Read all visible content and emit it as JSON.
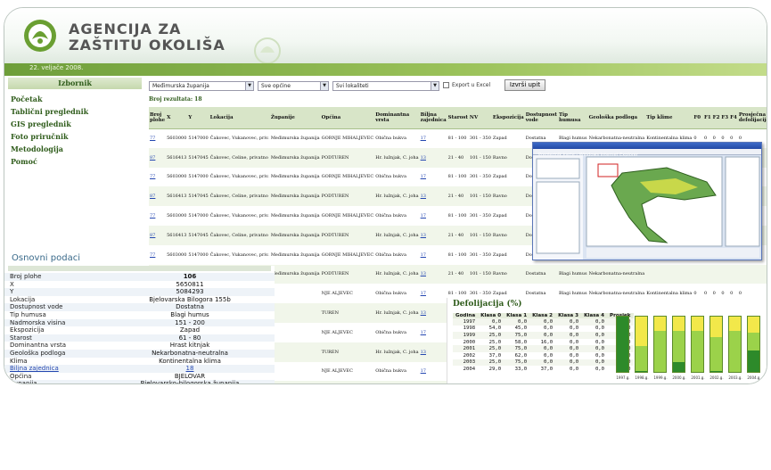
{
  "header": {
    "agency_line1": "AGENCIJA ZA",
    "agency_line2": "ZAŠTITU OKOLIŠA",
    "date": "22. veljače 2008."
  },
  "sidebar": {
    "title": "Izbornik",
    "items": [
      "Početak",
      "Tablični preglednik",
      "GIS preglednik",
      "Foto priručnik",
      "Metodologija",
      "Pomoć"
    ]
  },
  "filters": {
    "county": "Međimurska županija",
    "municipality": "Sve općine",
    "locality": "Svi lokaliteti",
    "export_label": "Export u Excel",
    "submit": "Izvrši upit"
  },
  "results": {
    "label": "Broj rezultata: 18"
  },
  "table": {
    "headers": [
      "Broj plohe",
      "X",
      "Y",
      "Lokacija",
      "Županije",
      "Općina",
      "Dominantna vrsta",
      "Biljna zajednica",
      "Starost",
      "NV",
      "Ekspozicija",
      "Dostupnost vode",
      "Tip humusa",
      "Geološka podloga",
      "Tip klime",
      "F0",
      "F1",
      "F2",
      "F3",
      "F4",
      "Prosječna defolijacija",
      "C0",
      "C1",
      "C2",
      "C3",
      "Prosječna diskoloracija",
      "Godina"
    ],
    "rows": [
      [
        "77",
        "5603000",
        "5147000",
        "Čakovec, Vukanovec, priv.",
        "Međimurska županija",
        "GORNJE MIHALJEVEC",
        "Obična bukva",
        "17",
        "81 - 100",
        "301 - 350",
        "Zapad",
        "Dostatna",
        "Blagi humus",
        "Nekarbonatna-neutralna",
        "Kontinentalna klima",
        "0",
        "0",
        "0",
        "0",
        "0",
        "0",
        "0",
        "0",
        "0",
        "0",
        "0",
        "1997"
      ],
      [
        "87",
        "5616413",
        "5147045",
        "Čakovec, Celine, privatno",
        "Međimurska županija",
        "PODTUREN",
        "Hr. lužnjak, C. joha",
        "13",
        "21 - 40",
        "101 - 150",
        "Ravno",
        "Dostatna",
        "Blagi humus",
        "Nekarbonatna-neutralna",
        "Kontinentalna klima",
        "0",
        "0",
        "0",
        "0",
        "0",
        "0",
        "0",
        "0",
        "0",
        "0",
        "0",
        "1997"
      ],
      [
        "77",
        "5603000",
        "5147000",
        "Čakovec, Vukanovec, priv.",
        "Međimurska županija",
        "GORNJE MIHALJEVEC",
        "Obična bukva",
        "17",
        "81 - 100",
        "301 - 350",
        "Zapad",
        "Dostatna",
        "Blagi humus",
        "Nekarbonatna-neutralna",
        "",
        "",
        "",
        "",
        "",
        "",
        "",
        "",
        "",
        "",
        "",
        "",
        ""
      ],
      [
        "87",
        "5616413",
        "5147045",
        "Čakovec, Celine, privatno",
        "Međimurska županija",
        "PODTUREN",
        "Hr. lužnjak, C. joha",
        "13",
        "21 - 40",
        "101 - 150",
        "Ravno",
        "Dostatna",
        "Blagi humus",
        "Nekarbonatna-neutralna",
        "",
        "",
        "",
        "",
        "",
        "",
        "",
        "",
        "",
        "",
        "",
        "",
        ""
      ],
      [
        "77",
        "5603000",
        "5147000",
        "Čakovec, Vukanovec, priv.",
        "Međimurska županija",
        "GORNJE MIHALJEVEC",
        "Obična bukva",
        "17",
        "81 - 100",
        "301 - 350",
        "Zapad",
        "Dostatna",
        "Blagi humus",
        "Nekarbonatna-neutralna",
        "",
        "",
        "",
        "",
        "",
        "",
        "",
        "",
        "",
        "",
        "",
        "",
        ""
      ],
      [
        "87",
        "5616413",
        "5147045",
        "Čakovec, Celine, privatno",
        "Međimurska županija",
        "PODTUREN",
        "Hr. lužnjak, C. joha",
        "13",
        "21 - 40",
        "101 - 150",
        "Ravno",
        "Dostatna",
        "Blagi humus",
        "Nekarbonatna-neutralna",
        "",
        "",
        "",
        "",
        "",
        "",
        "",
        "",
        "",
        "",
        "",
        "",
        ""
      ],
      [
        "77",
        "5603000",
        "5147000",
        "Čakovec, Vukanovec, priv.",
        "Međimurska županija",
        "GORNJE MIHALJEVEC",
        "Obična bukva",
        "17",
        "81 - 100",
        "301 - 350",
        "Zapad",
        "Dostatna",
        "Blagi humus",
        "Nekarbonatna-neutralna",
        "",
        "",
        "",
        "",
        "",
        "",
        "",
        "",
        "",
        "",
        "",
        "",
        ""
      ],
      [
        "87",
        "5616413",
        "5147045",
        "Čakovec, Celine, privatno",
        "Međimurska županija",
        "PODTUREN",
        "Hr. lužnjak, C. joha",
        "13",
        "21 - 40",
        "101 - 150",
        "Ravno",
        "Dostatna",
        "Blagi humus",
        "Nekarbonatna-neutralna",
        "",
        "",
        "",
        "",
        "",
        "",
        "",
        "",
        "",
        "",
        "",
        "",
        ""
      ],
      [
        "",
        "",
        "",
        "Čakovec,",
        "",
        "NJE ALJEVEC",
        "Obična bukva",
        "17",
        "81 - 100",
        "301 - 350",
        "Zapad",
        "Dostatna",
        "Blagi humus",
        "Nekarbonatna-neutralna",
        "Kontinentalna klima",
        "0",
        "0",
        "0",
        "0",
        "0",
        "0",
        "0",
        "0",
        "0",
        "0",
        "0",
        "1997"
      ],
      [
        "",
        "",
        "",
        "",
        "",
        "TUREN",
        "Hr. lužnjak, C. joha",
        "13",
        "21 - 40",
        "101 - 150",
        "Ravno",
        "Dostatna",
        "Blagi humus",
        "Nekarbonatna-neutralna",
        "Kontinentalna klima",
        "0",
        "0",
        "0",
        "0",
        "0",
        "0",
        "0",
        "0",
        "0",
        "0",
        "0",
        "2001"
      ],
      [
        "",
        "",
        "",
        "",
        "",
        "NJE ALJEVEC",
        "Obična bukva",
        "17",
        "81 - 100",
        "301 - 350",
        "Zapad",
        "Dostatna",
        "Blagi humus",
        "Nekarbonatna-neutralna",
        "Kontinentalna klima",
        "100",
        "0",
        "0",
        "0",
        "0",
        "5",
        "95",
        "4",
        "0",
        "0",
        "5",
        "2002"
      ],
      [
        "",
        "",
        "",
        "",
        "",
        "TUREN",
        "Hr. lužnjak, C. joha",
        "13",
        "21 - 40",
        "101 - 150",
        "Ravno",
        "",
        "",
        "",
        "",
        "",
        "",
        "",
        "",
        "",
        "",
        "",
        "",
        "",
        "",
        "",
        ""
      ],
      [
        "",
        "",
        "",
        "",
        "",
        "NJE ALJEVEC",
        "Obična bukva",
        "17",
        "81 - 100",
        "301 - 350",
        "Zapad",
        "",
        "",
        "",
        "",
        "",
        "",
        "",
        "",
        "",
        "",
        "",
        "",
        "",
        "",
        "",
        ""
      ],
      [
        "",
        "",
        "",
        "",
        "",
        "TUREN",
        "Hr. lužnjak, C. joha",
        "13",
        "21 - 40",
        "101 - 150",
        "Ravno",
        "",
        "",
        "",
        "",
        "",
        "",
        "",
        "",
        "",
        "",
        "",
        "",
        "",
        "",
        "",
        ""
      ],
      [
        "",
        "",
        "",
        "",
        "",
        "NJE ALJEVEC",
        "Obična bukva",
        "17",
        "81 - 100",
        "301 - 350",
        "Zapad",
        "",
        "",
        "",
        "",
        "",
        "",
        "",
        "",
        "",
        "",
        "",
        "",
        "",
        "",
        "",
        ""
      ],
      [
        "",
        "",
        "",
        "",
        "",
        "TUREN",
        "Hr. lužnjak, C. joha",
        "13",
        "21 - 40",
        "101 - 150",
        "Ravno",
        "",
        "",
        "",
        "",
        "",
        "",
        "",
        "",
        "",
        "",
        "",
        "",
        "",
        "",
        "",
        ""
      ]
    ]
  },
  "basic_data": {
    "title": "Osnovni podaci",
    "rows": [
      {
        "k": "Broj plohe",
        "v": "106"
      },
      {
        "k": "X",
        "v": "5650811"
      },
      {
        "k": "Y",
        "v": "5084293"
      },
      {
        "k": "Lokacija",
        "v": "Bjelovarska Bilogora 155b"
      },
      {
        "k": "Dostupnost vode",
        "v": "Dostatna"
      },
      {
        "k": "Tip humusa",
        "v": "Blagi humus"
      },
      {
        "k": "Nadmorska visina",
        "v": "151 - 200"
      },
      {
        "k": "Ekspozicija",
        "v": "Zapad"
      },
      {
        "k": "Starost",
        "v": "61 - 80"
      },
      {
        "k": "Dominantna vrsta",
        "v": "Hrast kitnjak"
      },
      {
        "k": "Geološka podloga",
        "v": "Nekarbonatna-neutralna"
      },
      {
        "k": "Klima",
        "v": "Kontinentalna klima"
      },
      {
        "k": "Biljna zajednica",
        "v": "18"
      },
      {
        "k": "Općina",
        "v": "BJELOVAR"
      },
      {
        "k": "Županija",
        "v": "Bjelovarsko-bilogorska županija"
      }
    ]
  },
  "gis_window": {
    "title": "Preglednik karte - Windows Internet Explorer"
  },
  "defoliation": {
    "title": "Defolijacija (%)",
    "headers": [
      "Godina",
      "Klasa 0",
      "Klasa 1",
      "Klasa 2",
      "Klasa 3",
      "Klasa 4",
      "Prosjek"
    ],
    "rows": [
      [
        "1997",
        "0,0",
        "0,0",
        "0,0",
        "0,0",
        "0,0",
        "0,00"
      ],
      [
        "1998",
        "54,0",
        "45,0",
        "0,0",
        "0,0",
        "0,0",
        "10,00"
      ],
      [
        "1999",
        "25,0",
        "75,0",
        "0,0",
        "0,0",
        "0,0",
        "14,00"
      ],
      [
        "2000",
        "25,0",
        "58,0",
        "16,0",
        "0,0",
        "0,0",
        "18,00"
      ],
      [
        "2001",
        "25,0",
        "75,0",
        "0,0",
        "0,0",
        "0,0",
        "14,00"
      ],
      [
        "2002",
        "37,0",
        "62,0",
        "0,0",
        "0,0",
        "0,0",
        "12,00"
      ],
      [
        "2003",
        "25,0",
        "75,0",
        "0,0",
        "0,0",
        "0,0",
        "14,00"
      ],
      [
        "2004",
        "29,0",
        "33,0",
        "37,0",
        "0,0",
        "0,0",
        "22,00"
      ]
    ]
  },
  "chart_data": {
    "type": "bar",
    "categories": [
      "1997.g.",
      "1998.g.",
      "1999.g.",
      "2000.g.",
      "2001.g.",
      "2002.g.",
      "2003.g.",
      "2004.g."
    ],
    "series": [
      {
        "values": [
          0,
          54,
          25,
          25,
          25,
          37,
          25,
          29
        ]
      },
      {
        "values": [
          0,
          45,
          75,
          58,
          75,
          62,
          75,
          33
        ]
      },
      {
        "values": [
          0,
          0,
          0,
          16,
          0,
          0,
          0,
          37
        ]
      }
    ],
    "colors": [
      "#f2e84a",
      "#9bd24a",
      "#2d8a2a",
      "#1d6a1a"
    ]
  }
}
